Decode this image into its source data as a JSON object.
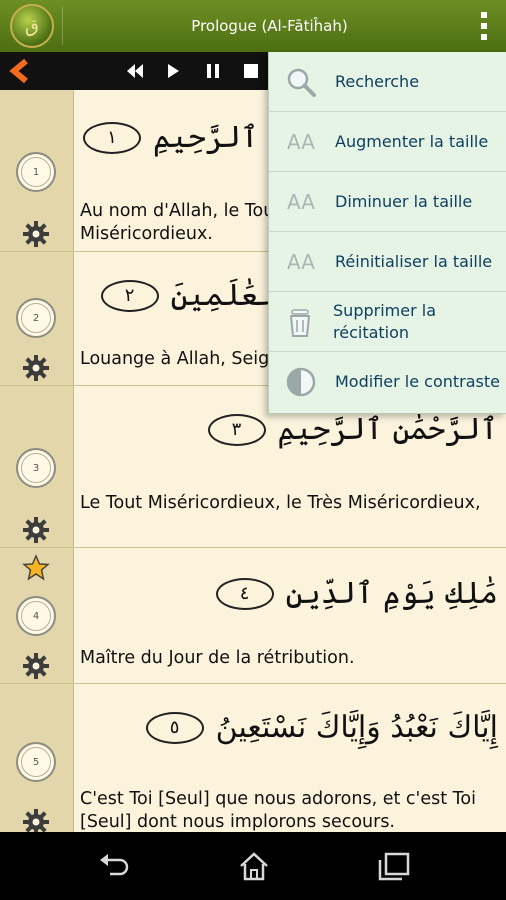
{
  "app": {
    "title": "Prologue (Al-Fātiĥah)",
    "logo_text": "ق",
    "colors": {
      "header": "#5a7c1a",
      "accent": "#f26b1d",
      "menu_bg": "#e6f4e6",
      "menu_text": "#0f3f60",
      "page": "#fbf3dc"
    }
  },
  "player": {
    "icons": [
      "back-arrow-icon",
      "previous-icon",
      "play-icon",
      "pause-icon",
      "stop-icon"
    ]
  },
  "verses": [
    {
      "number": "1",
      "arabic": "بِسْمِ ٱللَّهِ ٱلرَّحْمَٰنِ ٱلرَّحِيمِ",
      "ayah_mark": "١",
      "translation": "Au nom d'Allah, le Tout Miséricordieux, le Très Miséricordieux.",
      "starred": false
    },
    {
      "number": "2",
      "arabic": "ٱلْحَمْدُ لِلَّهِ رَبِّ ٱلْعَٰلَمِينَ",
      "ayah_mark": "٢",
      "translation": "Louange à Allah, Seigneur de l'univers.",
      "starred": false
    },
    {
      "number": "3",
      "arabic": "ٱلرَّحْمَٰنِ ٱلرَّحِيمِ",
      "ayah_mark": "٣",
      "translation": "Le Tout Miséricordieux, le Très Miséricordieux,",
      "starred": false
    },
    {
      "number": "4",
      "arabic": "مَٰلِكِ يَوْمِ ٱلدِّينِ",
      "ayah_mark": "٤",
      "translation": "Maître du Jour de la rétribution.",
      "starred": true
    },
    {
      "number": "5",
      "arabic": "إِيَّاكَ نَعْبُدُ وَإِيَّاكَ نَسْتَعِينُ",
      "ayah_mark": "٥",
      "translation": "C'est Toi [Seul] que nous adorons, et c'est Toi [Seul] dont nous implorons secours.",
      "starred": false
    }
  ],
  "menu": {
    "items": [
      {
        "label": "Recherche",
        "icon": "search-icon"
      },
      {
        "label": "Augmenter la taille",
        "icon": "increase-text-size-icon",
        "glyph": "AA"
      },
      {
        "label": "Diminuer la taille",
        "icon": "decrease-text-size-icon",
        "glyph": "AA"
      },
      {
        "label": "Réinitialiser la taille",
        "icon": "reset-text-size-icon",
        "glyph": "AA"
      },
      {
        "label": "Supprimer la récitation",
        "icon": "trash-icon"
      },
      {
        "label": "Modifier le contraste",
        "icon": "contrast-icon"
      }
    ]
  },
  "navbar": {
    "icons": [
      "back-icon",
      "home-icon",
      "recent-apps-icon"
    ]
  }
}
